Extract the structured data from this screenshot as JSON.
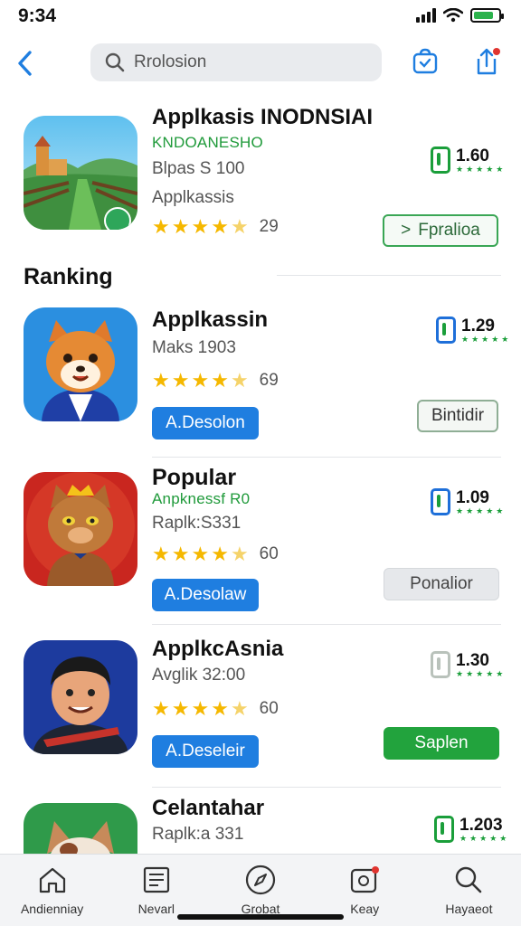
{
  "status": {
    "time": "9:34"
  },
  "search": {
    "placeholder": "Rrolosion"
  },
  "featured": {
    "title": "Applkasis INODNSIAI",
    "subtitle": "KNDOANESHO",
    "meta1": "Blpas S 100",
    "meta2": "Applkassis",
    "rating_count": "29",
    "rank_value": "1.60",
    "button_label": "Fpralioa",
    "button_prefix": ">"
  },
  "section": {
    "title": "Ranking"
  },
  "apps": [
    {
      "title": "Applkassin",
      "subtitle": "",
      "meta": "Maks 1903",
      "rating_count": "69",
      "rank_value": "1.29",
      "left_button": "A.Desolon",
      "right_button": "Bintidir"
    },
    {
      "title": "Popular",
      "subtitle": "Anpknessf R0",
      "meta": "Raplk:S331",
      "rating_count": "60",
      "rank_value": "1.09",
      "left_button": "A.Desolaw",
      "right_button": "Ponalior"
    },
    {
      "title": "ApplkcAsnia",
      "subtitle": "",
      "meta": "Avglik 32:00",
      "rating_count": "60",
      "rank_value": "1.30",
      "left_button": "A.Deseleir",
      "right_button": "Saplen"
    },
    {
      "title": "Celantahar",
      "subtitle": "",
      "meta": "Raplk:a 331",
      "rating_count": "",
      "rank_value": "1.203",
      "left_button": "",
      "right_button": ""
    }
  ],
  "tabs": [
    {
      "label": "Andienniay"
    },
    {
      "label": "Nevarl"
    },
    {
      "label": "Grobat"
    },
    {
      "label": "Keay"
    },
    {
      "label": "Hayaeot"
    }
  ],
  "colors": {
    "accent_blue": "#1f7ee0",
    "accent_green": "#22a33d",
    "star": "#f5b800"
  }
}
